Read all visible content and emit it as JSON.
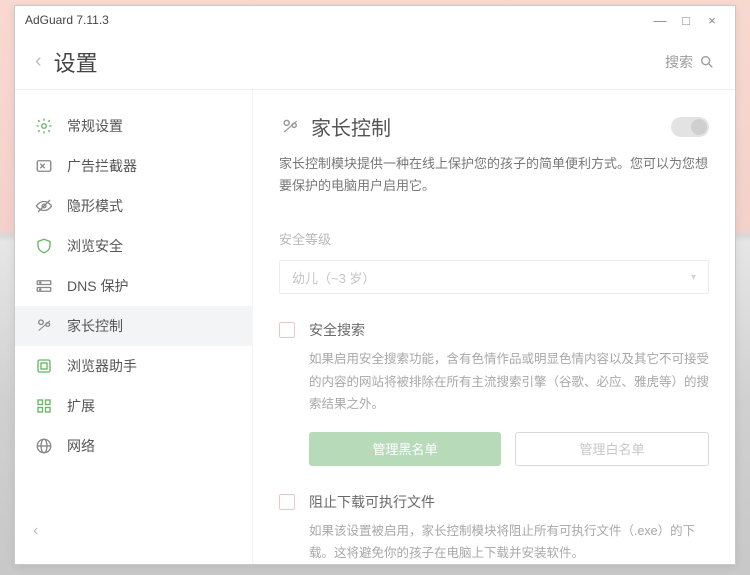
{
  "window": {
    "title": "AdGuard 7.11.3"
  },
  "header": {
    "title": "设置",
    "search_label": "搜索"
  },
  "sidebar": {
    "items": [
      {
        "label": "常规设置"
      },
      {
        "label": "广告拦截器"
      },
      {
        "label": "隐形模式"
      },
      {
        "label": "浏览安全"
      },
      {
        "label": "DNS 保护"
      },
      {
        "label": "家长控制"
      },
      {
        "label": "浏览器助手"
      },
      {
        "label": "扩展"
      },
      {
        "label": "网络"
      }
    ]
  },
  "content": {
    "title": "家长控制",
    "description": "家长控制模块提供一种在线上保护您的孩子的简单便利方式。您可以为您想要保护的电脑用户启用它。",
    "level_label": "安全等级",
    "level_value": "幼儿（~3 岁）",
    "safe_search": {
      "label": "安全搜索",
      "desc": "如果启用安全搜索功能，含有色情作品或明显色情内容以及其它不可接受的内容的网站将被排除在所有主流搜索引擎（谷歌、必应、雅虎等）的搜索结果之外。"
    },
    "buttons": {
      "blacklist": "管理黑名单",
      "whitelist": "管理白名单"
    },
    "block_exec": {
      "label": "阻止下载可执行文件",
      "desc": "如果该设置被启用，家长控制模块将阻止所有可执行文件（.exe）的下载。这将避免你的孩子在电脑上下载并安装软件。"
    }
  }
}
